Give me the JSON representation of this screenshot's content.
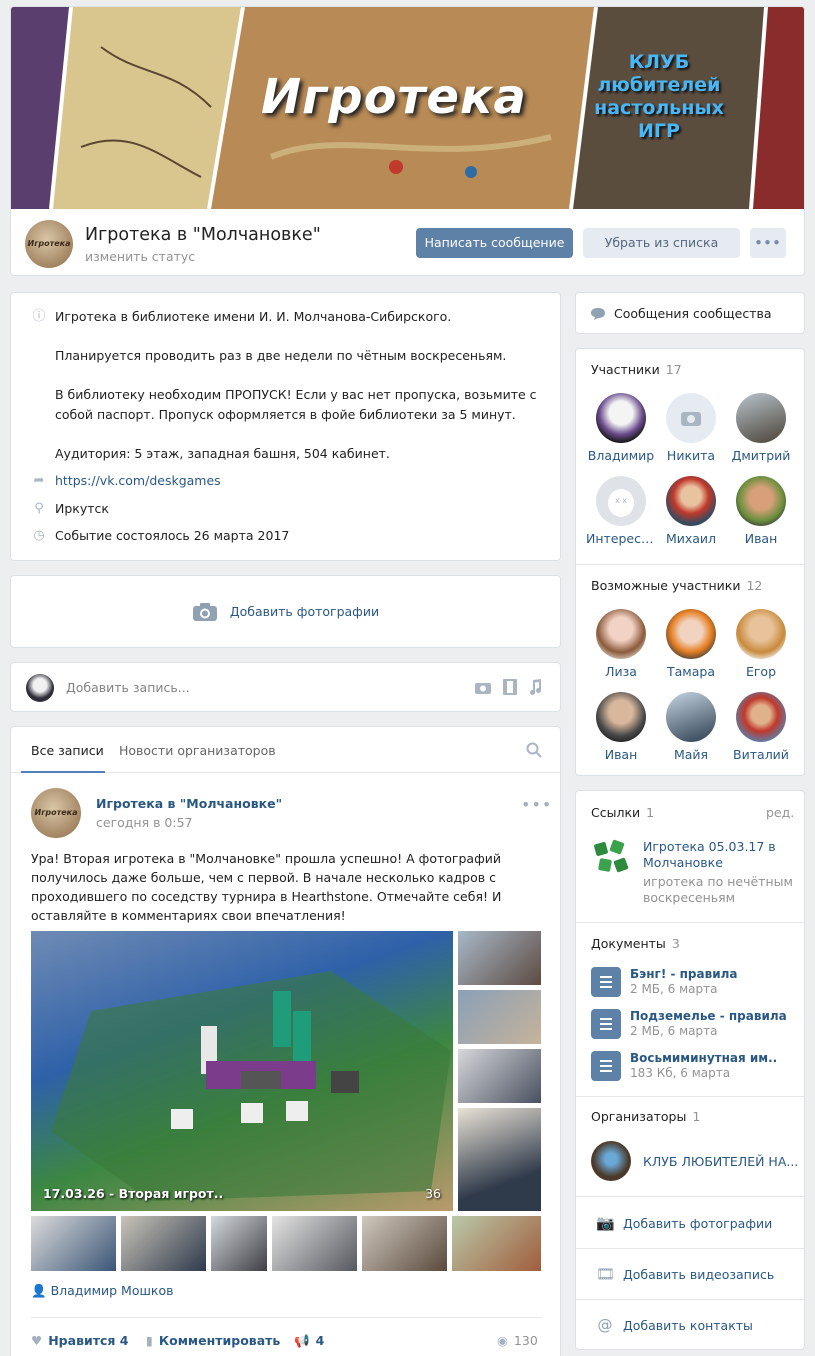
{
  "cover": {
    "title": "Игротека",
    "club_lines": [
      "КЛУБ",
      "любителей",
      "настольных",
      "ИГР"
    ]
  },
  "header": {
    "avatar_text": "Игротека",
    "name": "Игротека в \"Молчановке\"",
    "status": "изменить статус",
    "send_message": "Написать сообщение",
    "remove": "Убрать из списка",
    "more": "•••"
  },
  "info": {
    "description": "Игротека в библиотеке имени И. И. Молчанова-Сибирского.\n\nПланируется проводить раз в две недели по чётным воскресеньям.\n\nВ библиотеку необходим ПРОПУСК! Если у вас нет пропуска, возьмите с собой паспорт. Пропуск оформляется в фойе библиотеки за 5 минут.\n\nАудитория: 5 этаж, западная башня, 504 кабинет.",
    "link": "https://vk.com/deskgames",
    "city": "Иркутск",
    "event": "Событие состоялось 26 марта 2017"
  },
  "add_photos": "Добавить фотографии",
  "composer": {
    "placeholder": "Добавить запись..."
  },
  "wall": {
    "tabs": [
      "Все записи",
      "Новости организаторов"
    ],
    "post": {
      "author": "Игротека в \"Молчановке\"",
      "time": "сегодня в 0:57",
      "more": "•••",
      "text": "Ура! Вторая игротека в \"Молчановке\" прошла успешно! А фотографий получилось даже больше, чем с первой. В начале несколько кадров с проходившего по соседству турнира в Hearthstone. Отмечайте себя! И оставляйте в комментариях свои впечатления!",
      "photo_caption": "17.03.26 - Вторая игрот..",
      "photo_count": "36",
      "signer": "Владимир Мошков",
      "likes_label": "Нравится",
      "likes": "4",
      "comment_label": "Комментировать",
      "reposts": "4",
      "views": "130"
    }
  },
  "right": {
    "community_messages": "Сообщения сообщества",
    "members": {
      "title": "Участники",
      "count": "17",
      "items": [
        "Владимир",
        "Никита",
        "Дмитрий",
        "Интересн...",
        "Михаил",
        "Иван"
      ]
    },
    "possible": {
      "title": "Возможные участники",
      "count": "12",
      "items": [
        "Лиза",
        "Тамара",
        "Егор",
        "Иван",
        "Майя",
        "Виталий"
      ]
    },
    "links": {
      "title": "Ссылки",
      "count": "1",
      "edit": "ред.",
      "item_title": "Игротека 05.03.17 в Молчановке",
      "item_desc": "игротека по нечётным воскресеньям"
    },
    "docs": {
      "title": "Документы",
      "count": "3",
      "items": [
        {
          "name": "Бэнг! - правила",
          "meta": "2 МБ, 6 марта"
        },
        {
          "name": "Подземелье - правила",
          "meta": "2 МБ, 6 марта"
        },
        {
          "name": "Восьмиминутная им..",
          "meta": "183 Кб, 6 марта"
        }
      ]
    },
    "organizers": {
      "title": "Организаторы",
      "count": "1",
      "name": "КЛУБ ЛЮБИТЕЛЕЙ НА..."
    },
    "actions": [
      "Добавить фотографии",
      "Добавить видеозапись",
      "Добавить контакты"
    ]
  },
  "colors": {
    "accent": "#5181b8",
    "link": "#2a5885",
    "button": "#5e81a8",
    "background": "#edeef0"
  }
}
